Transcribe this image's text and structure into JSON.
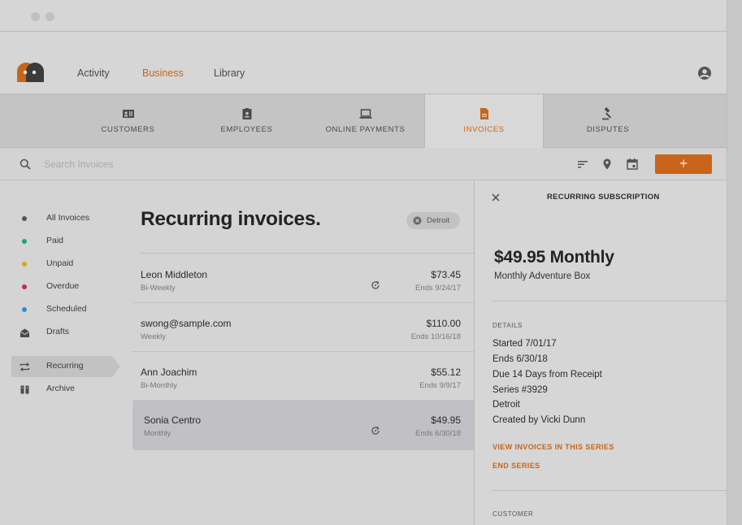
{
  "nav": {
    "links": [
      {
        "label": "Activity"
      },
      {
        "label": "Business"
      },
      {
        "label": "Library"
      }
    ]
  },
  "tabs": [
    {
      "label": "CUSTOMERS",
      "icon": "id-card-icon"
    },
    {
      "label": "EMPLOYEES",
      "icon": "badge-icon"
    },
    {
      "label": "ONLINE PAYMENTS",
      "icon": "laptop-icon"
    },
    {
      "label": "INVOICES",
      "icon": "document-icon"
    },
    {
      "label": "DISPUTES",
      "icon": "gavel-icon"
    }
  ],
  "toolbar": {
    "search_placeholder": "Search Invoices",
    "add_label": "+"
  },
  "sidebar": {
    "items": [
      {
        "label": "All Invoices",
        "color": "#555555"
      },
      {
        "label": "Paid",
        "color": "#1ea36a"
      },
      {
        "label": "Unpaid",
        "color": "#d8a51a"
      },
      {
        "label": "Overdue",
        "color": "#c8284a"
      },
      {
        "label": "Scheduled",
        "color": "#2a8fd0"
      },
      {
        "label": "Drafts",
        "icon": "envelope-open-icon"
      },
      {
        "label": "Recurring",
        "icon": "repeat-icon"
      },
      {
        "label": "Archive",
        "icon": "archive-icon"
      }
    ]
  },
  "main": {
    "title": "Recurring invoices.",
    "filter_chip": "Detroit",
    "rows": [
      {
        "name": "Leon Middleton",
        "frequency": "Bi-Weekly",
        "amount": "$73.45",
        "ends": "Ends 9/24/17",
        "recurring_icon": true
      },
      {
        "name": "swong@sample.com",
        "frequency": "Weekly",
        "amount": "$110.00",
        "ends": "Ends 10/16/18",
        "recurring_icon": false
      },
      {
        "name": "Ann Joachim",
        "frequency": "Bi-Monthly",
        "amount": "$55.12",
        "ends": "Ends 9/9/17",
        "recurring_icon": false
      },
      {
        "name": "Sonia Centro",
        "frequency": "Monthly",
        "amount": "$49.95",
        "ends": "Ends 6/30/18",
        "recurring_icon": true
      }
    ]
  },
  "detail": {
    "title": "RECURRING SUBSCRIPTION",
    "price": "$49.95 Monthly",
    "product": "Monthly Adventure Box",
    "details_label": "DETAILS",
    "details": [
      "Started 7/01/17",
      "Ends 6/30/18",
      "Due 14 Days from Receipt",
      "Series #3929",
      "Detroit",
      "Created by Vicki Dunn"
    ],
    "link_view": "VIEW INVOICES IN THIS SERIES",
    "link_end": "END SERIES",
    "customer_label": "CUSTOMER"
  },
  "colors": {
    "accent": "#c8651a"
  }
}
